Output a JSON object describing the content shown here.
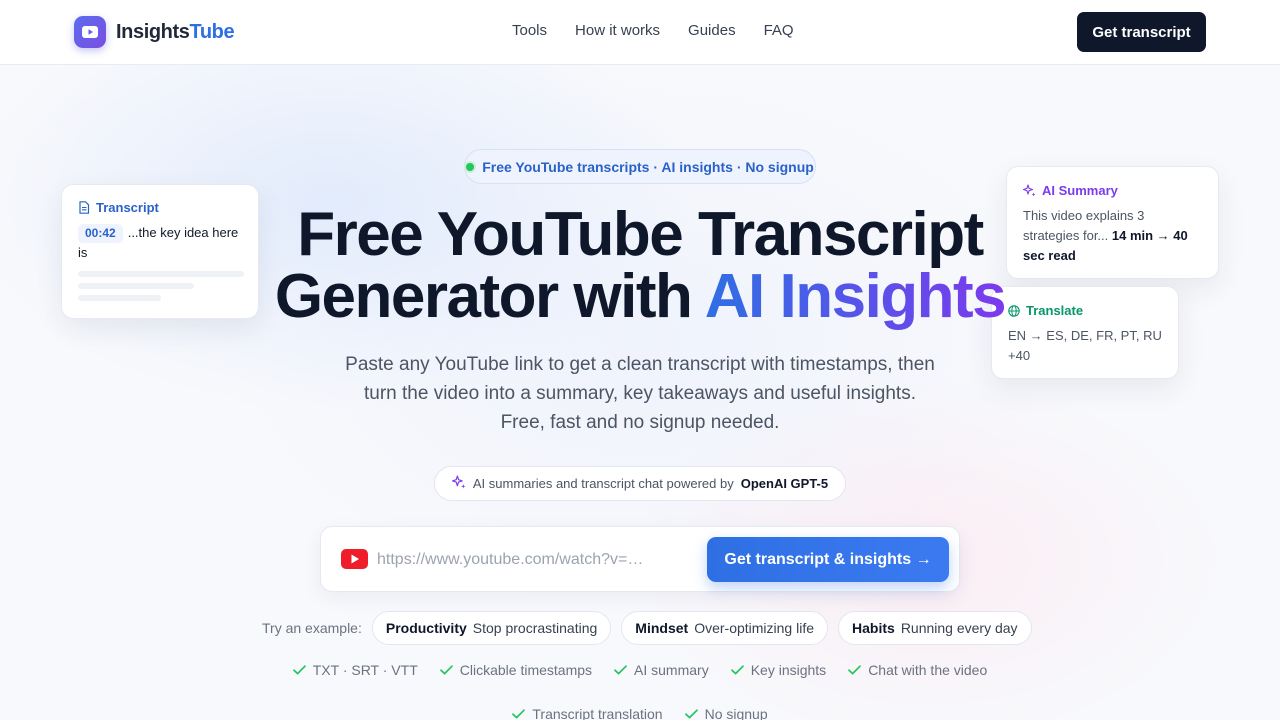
{
  "brand": {
    "name_part1": "Insights",
    "name_part2": "Tube",
    "accent": "#2f6fe4"
  },
  "nav": {
    "items": [
      {
        "label": "Tools"
      },
      {
        "label": "How it works"
      },
      {
        "label": "Guides"
      },
      {
        "label": "FAQ"
      }
    ]
  },
  "header": {
    "cta_label": "Get transcript"
  },
  "hero": {
    "badge": "Free YouTube transcripts · AI insights · No signup",
    "title_line1": "Free YouTube Transcript",
    "title_line2_plain": "Generator with ",
    "title_line2_accent": "AI Insights",
    "subtitle": "Paste any YouTube link to get a clean transcript with timestamps, then turn the video into a summary, key takeaways and useful insights. Free, fast and no signup needed.",
    "powered_text": "AI summaries and transcript chat powered by",
    "powered_model": "OpenAI GPT-5"
  },
  "form": {
    "url_placeholder": "https://www.youtube.com/watch?v=…",
    "url_value": "",
    "submit_label": "Get transcript & insights →"
  },
  "examples": {
    "label": "Try an example:",
    "items": [
      {
        "category": "Productivity",
        "text": "Stop procrastinating"
      },
      {
        "category": "Mindset",
        "text": "Over-optimizing life"
      },
      {
        "category": "Habits",
        "text": "Running every day"
      }
    ]
  },
  "features": {
    "row1": [
      "TXT · SRT · VTT",
      "Clickable timestamps",
      "AI summary",
      "Key insights",
      "Chat with the video"
    ],
    "row2": [
      "Transcript translation",
      "No signup"
    ]
  },
  "cards": {
    "transcript": {
      "title": "Transcript",
      "timestamp": "00:42",
      "text": "...the key idea here is"
    },
    "summary": {
      "title": "AI Summary",
      "text": "This video explains 3 strategies for... ",
      "highlight": "14 min → 40 sec read"
    },
    "translate": {
      "title": "Translate",
      "text": "EN → ES, DE, FR, PT, RU +40"
    }
  },
  "colors": {
    "dark": "#0f172a",
    "primary": "#2f6fe4",
    "purple": "#7c3aed",
    "green": "#22c55e",
    "youtube_red": "#ef1c2a"
  },
  "icons": {
    "logo": "play-icon",
    "youtube": "youtube-icon",
    "check": "check-icon",
    "sparkle": "sparkle-icon",
    "document": "document-icon",
    "globe": "globe-icon"
  }
}
